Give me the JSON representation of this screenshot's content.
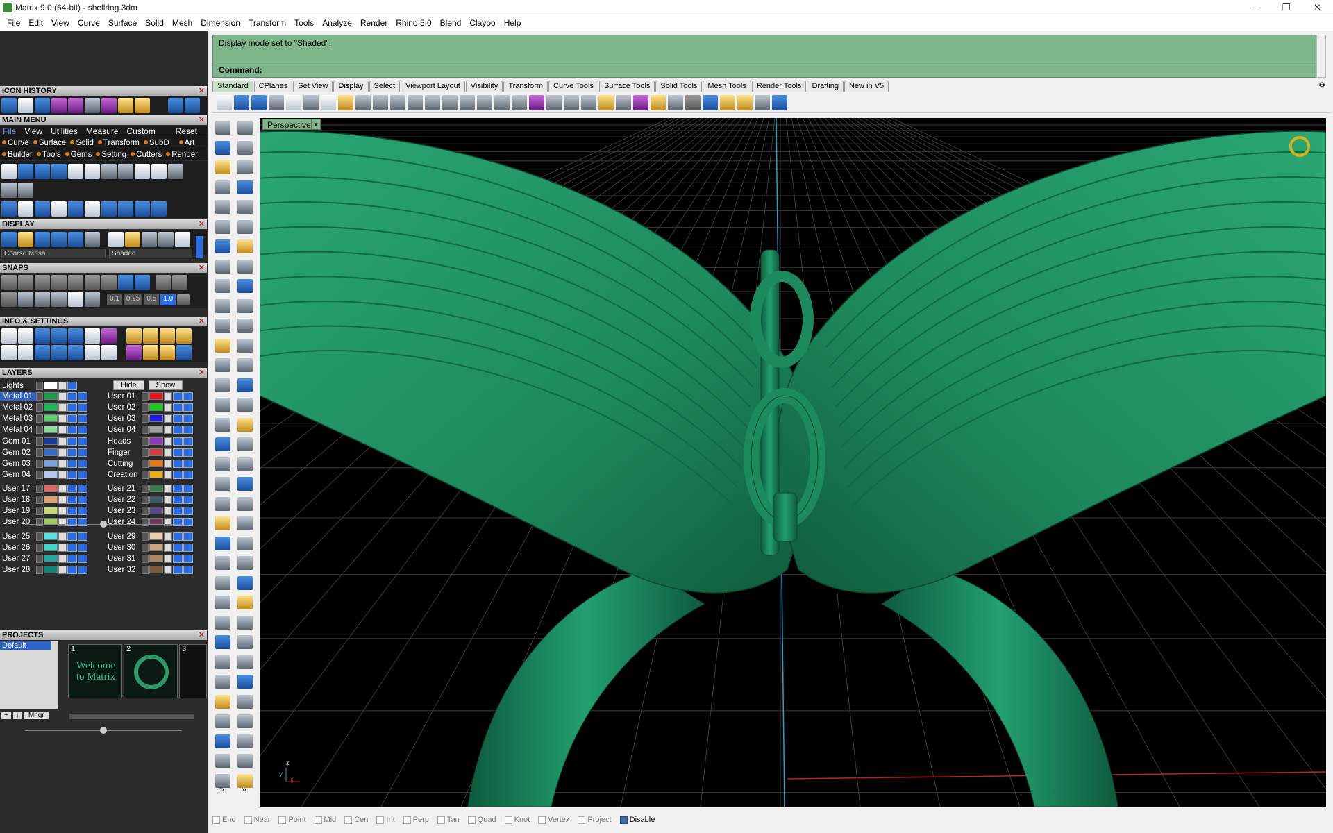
{
  "window": {
    "title": "Matrix 9.0 (64-bit) - shellring.3dm",
    "minimize": "—",
    "restore": "❐",
    "close": "✕"
  },
  "menu": [
    "File",
    "Edit",
    "View",
    "Curve",
    "Surface",
    "Solid",
    "Mesh",
    "Dimension",
    "Transform",
    "Tools",
    "Analyze",
    "Render",
    "Rhino 5.0",
    "Blend",
    "Clayoo",
    "Help"
  ],
  "panel": {
    "icon_history": "ICON HISTORY",
    "main_menu": "MAIN MENU",
    "main_tabs": [
      "File",
      "View",
      "Utilities",
      "Measure",
      "Custom"
    ],
    "reset": "Reset",
    "row1": [
      "Curve",
      "Surface",
      "Solid",
      "Transform",
      "SubD",
      "Art"
    ],
    "row2": [
      "Builder",
      "Tools",
      "Gems",
      "Setting",
      "Cutters",
      "Render"
    ],
    "display": "DISPLAY",
    "display_mesh": "Coarse Mesh",
    "display_mode": "Shaded",
    "snaps": "SNAPS",
    "snap_steps": [
      "0.1",
      "0.25",
      "0.5",
      "1.0"
    ],
    "info_settings": "INFO & SETTINGS",
    "layers": "LAYERS",
    "lights": "Lights",
    "hide": "Hide",
    "show": "Show",
    "layer_left": [
      {
        "name": "Metal 01",
        "color": "#1a9a4a"
      },
      {
        "name": "Metal 02",
        "color": "#1ab85a"
      },
      {
        "name": "Metal 03",
        "color": "#5ad070"
      },
      {
        "name": "Metal 04",
        "color": "#8adc9a"
      },
      {
        "name": "Gem 01",
        "color": "#1a3a9a"
      },
      {
        "name": "Gem 02",
        "color": "#3a6ac8"
      },
      {
        "name": "Gem 03",
        "color": "#7aa0e0"
      },
      {
        "name": "Gem 04",
        "color": "#b4c8f0"
      },
      {
        "name": "User 17",
        "color": "#e06a6a"
      },
      {
        "name": "User 18",
        "color": "#e0a070"
      },
      {
        "name": "User 19",
        "color": "#c8d870"
      },
      {
        "name": "User 20",
        "color": "#a0c860"
      },
      {
        "name": "User 25",
        "color": "#5ae0e0"
      },
      {
        "name": "User 26",
        "color": "#40d8c8"
      },
      {
        "name": "User 27",
        "color": "#20a8a0"
      },
      {
        "name": "User 28",
        "color": "#108878"
      }
    ],
    "layer_right": [
      {
        "name": "User 01",
        "color": "#e01a1a"
      },
      {
        "name": "User 02",
        "color": "#1ad01a"
      },
      {
        "name": "User 03",
        "color": "#1a1ae0"
      },
      {
        "name": "User 04",
        "color": "#a0a0a0"
      },
      {
        "name": "Heads",
        "color": "#8a3ab8"
      },
      {
        "name": "Finger",
        "color": "#c84040"
      },
      {
        "name": "Cutting",
        "color": "#e07a1a"
      },
      {
        "name": "Creation",
        "color": "#e8b020"
      },
      {
        "name": "User 21",
        "color": "#3a7a4a"
      },
      {
        "name": "User 22",
        "color": "#3a5a6a"
      },
      {
        "name": "User 23",
        "color": "#5a4a8a"
      },
      {
        "name": "User 24",
        "color": "#6a3a5a"
      },
      {
        "name": "User 29",
        "color": "#e8d0b0"
      },
      {
        "name": "User 30",
        "color": "#c8a880"
      },
      {
        "name": "User 31",
        "color": "#a88860"
      },
      {
        "name": "User 32",
        "color": "#7a5a3a"
      }
    ],
    "projects": "PROJECTS",
    "project_default": "Default",
    "thumb_numbers": [
      "1",
      "2",
      "3"
    ],
    "thumb1_text": "Welcome to Matrix",
    "mngr": "Mngr"
  },
  "command": {
    "history": "Display mode set to \"Shaded\".",
    "prompt": "Command:"
  },
  "toolbar_tabs": [
    "Standard",
    "CPlanes",
    "Set View",
    "Display",
    "Select",
    "Viewport Layout",
    "Visibility",
    "Transform",
    "Curve Tools",
    "Surface Tools",
    "Solid Tools",
    "Mesh Tools",
    "Render Tools",
    "Drafting",
    "New in V5"
  ],
  "viewport": {
    "name": "Perspective",
    "axis_z": "z",
    "axis_y": "y",
    "axis_x": "x",
    "more_left": "»",
    "more_right": "»"
  },
  "osnaps": [
    {
      "label": "End",
      "on": false
    },
    {
      "label": "Near",
      "on": false
    },
    {
      "label": "Point",
      "on": false
    },
    {
      "label": "Mid",
      "on": false
    },
    {
      "label": "Cen",
      "on": false
    },
    {
      "label": "Int",
      "on": false
    },
    {
      "label": "Perp",
      "on": false
    },
    {
      "label": "Tan",
      "on": false
    },
    {
      "label": "Quad",
      "on": false
    },
    {
      "label": "Knot",
      "on": false
    },
    {
      "label": "Vertex",
      "on": false
    },
    {
      "label": "Project",
      "on": false
    },
    {
      "label": "Disable",
      "on": true
    }
  ],
  "colors": {
    "command_bg": "#7fb58b",
    "model_green": "#1f8a5e",
    "viewport_bg": "#000000"
  }
}
